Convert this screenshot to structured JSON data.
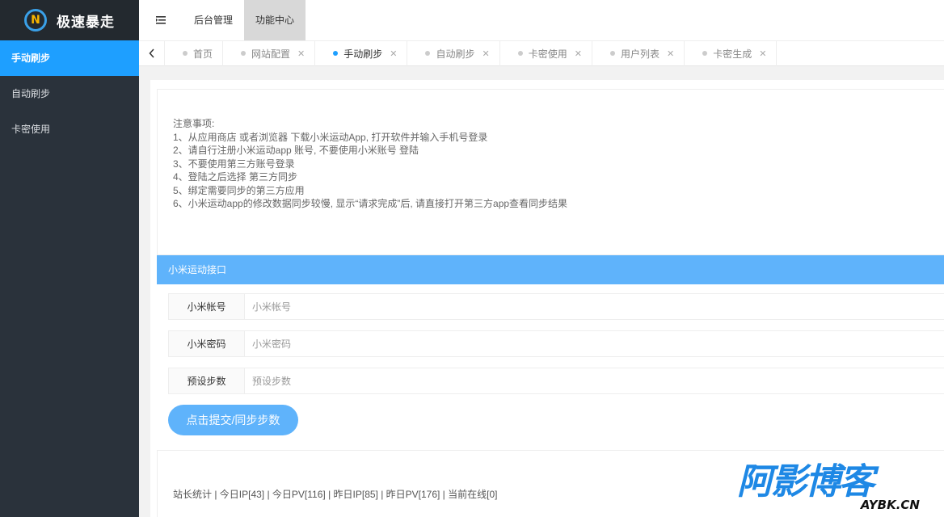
{
  "app": {
    "title": "极速暴走"
  },
  "sidebar": {
    "items": [
      {
        "label": "手动刷步",
        "active": true
      },
      {
        "label": "自动刷步",
        "active": false
      },
      {
        "label": "卡密使用",
        "active": false
      }
    ]
  },
  "header": {
    "nav": [
      {
        "label": "后台管理",
        "active": false
      },
      {
        "label": "功能中心",
        "active": true
      }
    ]
  },
  "tabs": [
    {
      "label": "首页",
      "closable": false,
      "active": false
    },
    {
      "label": "网站配置",
      "closable": true,
      "active": false
    },
    {
      "label": "手动刷步",
      "closable": true,
      "active": true
    },
    {
      "label": "自动刷步",
      "closable": true,
      "active": false
    },
    {
      "label": "卡密使用",
      "closable": true,
      "active": false
    },
    {
      "label": "用户列表",
      "closable": true,
      "active": false
    },
    {
      "label": "卡密生成",
      "closable": true,
      "active": false
    }
  ],
  "notice": {
    "title": "注意事项:",
    "lines": [
      "1、从应用商店 或者浏览器 下载小米运动App, 打开软件并输入手机号登录",
      "2、请自行注册小米运动app 账号, 不要使用小米账号 登陆",
      "3、不要使用第三方账号登录",
      "4、登陆之后选择 第三方同步",
      "5、绑定需要同步的第三方应用",
      "6、小米运动app的修改数据同步较慢, 显示“请求完成”后, 请直接打开第三方app查看同步结果"
    ]
  },
  "form": {
    "section_title": "小米运动接口",
    "account": {
      "label": "小米帐号",
      "placeholder": "小米帐号",
      "value": ""
    },
    "password": {
      "label": "小米密码",
      "placeholder": "小米密码",
      "value": ""
    },
    "steps": {
      "label": "预设步数",
      "placeholder": "预设步数",
      "value": ""
    },
    "submit_label": "点击提交/同步步数"
  },
  "footer": {
    "stats": "站长统计 | 今日IP[43] | 今日PV[116] | 昨日IP[85] | 昨日PV[176] | 当前在线[0]"
  },
  "watermark": {
    "cn": "阿影博客",
    "en": "AYBK.CN"
  },
  "colors": {
    "accent": "#1e9fff",
    "sidebar": "#2a323b",
    "section": "#5fb3fb"
  }
}
